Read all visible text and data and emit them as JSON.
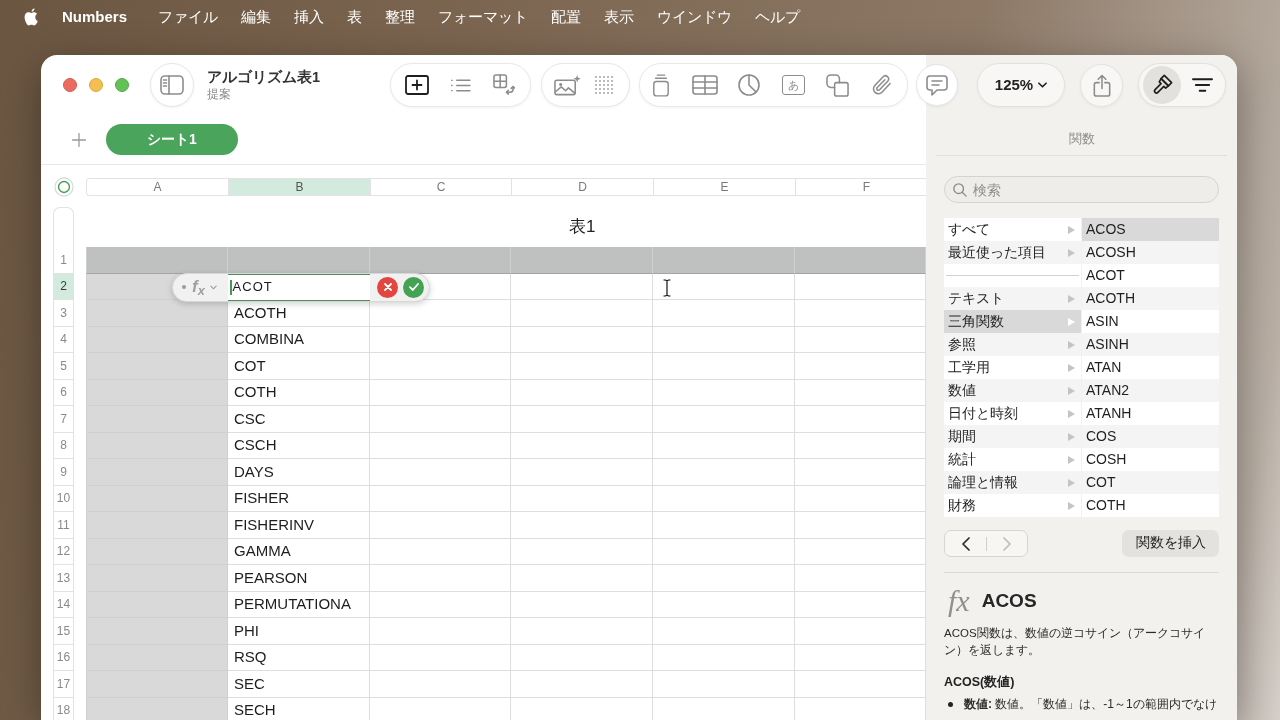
{
  "menu_bar": {
    "app_name": "Numbers",
    "items": [
      "ファイル",
      "編集",
      "挿入",
      "表",
      "整理",
      "フォーマット",
      "配置",
      "表示",
      "ウインドウ",
      "ヘルプ"
    ]
  },
  "window": {
    "title": "アルゴリズム表1",
    "subtitle": "提案"
  },
  "toolbar": {
    "text_box_glyph": "あ",
    "zoom": "125%",
    "sidebar_buttons": [
      {
        "kind": "format",
        "selected": true
      },
      {
        "kind": "organize",
        "selected": false
      }
    ]
  },
  "sheet_tabs": [
    {
      "label": "シート1",
      "selected": true
    }
  ],
  "table": {
    "title": "表1",
    "columns": [
      {
        "label": "A",
        "kind": "header",
        "selected": false
      },
      {
        "label": "B",
        "kind": "body",
        "selected": true
      },
      {
        "label": "C",
        "kind": "body",
        "selected": false
      },
      {
        "label": "D",
        "kind": "body",
        "selected": false
      },
      {
        "label": "E",
        "kind": "body",
        "selected": false
      },
      {
        "label": "F",
        "kind": "body",
        "selected": false
      }
    ],
    "rows": [
      {
        "number": "1",
        "kind": "header",
        "selected": false
      },
      {
        "number": "2",
        "kind": "body",
        "selected": true,
        "editor": {
          "symbol": "f$_{x}$",
          "value": "ACOT"
        }
      },
      {
        "number": "3",
        "kind": "body",
        "selected": false,
        "column_b": "ACOTH"
      },
      {
        "number": "4",
        "kind": "body",
        "selected": false,
        "column_b": "COMBINA"
      },
      {
        "number": "5",
        "kind": "body",
        "selected": false,
        "column_b": "COT"
      },
      {
        "number": "6",
        "kind": "body",
        "selected": false,
        "column_b": "COTH"
      },
      {
        "number": "7",
        "kind": "body",
        "selected": false,
        "column_b": "CSC"
      },
      {
        "number": "8",
        "kind": "body",
        "selected": false,
        "column_b": "CSCH"
      },
      {
        "number": "9",
        "kind": "body",
        "selected": false,
        "column_b": "DAYS"
      },
      {
        "number": "10",
        "kind": "body",
        "selected": false,
        "column_b": "FISHER"
      },
      {
        "number": "11",
        "kind": "body",
        "selected": false,
        "column_b": "FISHERINV"
      },
      {
        "number": "12",
        "kind": "body",
        "selected": false,
        "column_b": "GAMMA"
      },
      {
        "number": "13",
        "kind": "body",
        "selected": false,
        "column_b": "PEARSON"
      },
      {
        "number": "14",
        "kind": "body",
        "selected": false,
        "column_b": "PERMUTATIONA"
      },
      {
        "number": "15",
        "kind": "body",
        "selected": false,
        "column_b": "PHI"
      },
      {
        "number": "16",
        "kind": "body",
        "selected": false,
        "column_b": "RSQ"
      },
      {
        "number": "17",
        "kind": "body",
        "selected": false,
        "column_b": "SEC"
      },
      {
        "number": "18",
        "kind": "body",
        "selected": false,
        "column_b": "SECH"
      }
    ]
  },
  "function_browser": {
    "title": "関数",
    "search": {
      "placeholder": "検索"
    },
    "categories": [
      {
        "kind": "category",
        "label": "すべて",
        "selected": false
      },
      {
        "kind": "category",
        "label": "最近使った項目",
        "selected": false
      },
      {
        "kind": "separator"
      },
      {
        "kind": "category",
        "label": "テキスト",
        "selected": false
      },
      {
        "kind": "category",
        "label": "三角関数",
        "selected": true
      },
      {
        "kind": "category",
        "label": "参照",
        "selected": false
      },
      {
        "kind": "category",
        "label": "工学用",
        "selected": false
      },
      {
        "kind": "category",
        "label": "数値",
        "selected": false
      },
      {
        "kind": "category",
        "label": "日付と時刻",
        "selected": false
      },
      {
        "kind": "category",
        "label": "期間",
        "selected": false
      },
      {
        "kind": "category",
        "label": "統計",
        "selected": false
      },
      {
        "kind": "category",
        "label": "論理と情報",
        "selected": false
      },
      {
        "kind": "category",
        "label": "財務",
        "selected": false
      }
    ],
    "functions": [
      {
        "label": "ACOS",
        "selected": true
      },
      {
        "label": "ACOSH",
        "selected": false
      },
      {
        "label": "ACOT",
        "selected": false
      },
      {
        "label": "ACOTH",
        "selected": false
      },
      {
        "label": "ASIN",
        "selected": false
      },
      {
        "label": "ASINH",
        "selected": false
      },
      {
        "label": "ATAN",
        "selected": false
      },
      {
        "label": "ATAN2",
        "selected": false
      },
      {
        "label": "ATANH",
        "selected": false
      },
      {
        "label": "COS",
        "selected": false
      },
      {
        "label": "COSH",
        "selected": false
      },
      {
        "label": "COT",
        "selected": false
      },
      {
        "label": "COTH",
        "selected": false
      }
    ],
    "back_disabled": false,
    "forward_disabled": true,
    "insert_button": "関数を挿入",
    "detail": {
      "symbol": "fx",
      "name": "ACOS",
      "description": "ACOS関数は、数値の逆コサイン（アークコサイン）を返します。",
      "syntax": "ACOS(数値)",
      "arguments": [
        "**数値:** 数値。「数値」は、-1～1の範囲内でなけ"
      ]
    }
  }
}
